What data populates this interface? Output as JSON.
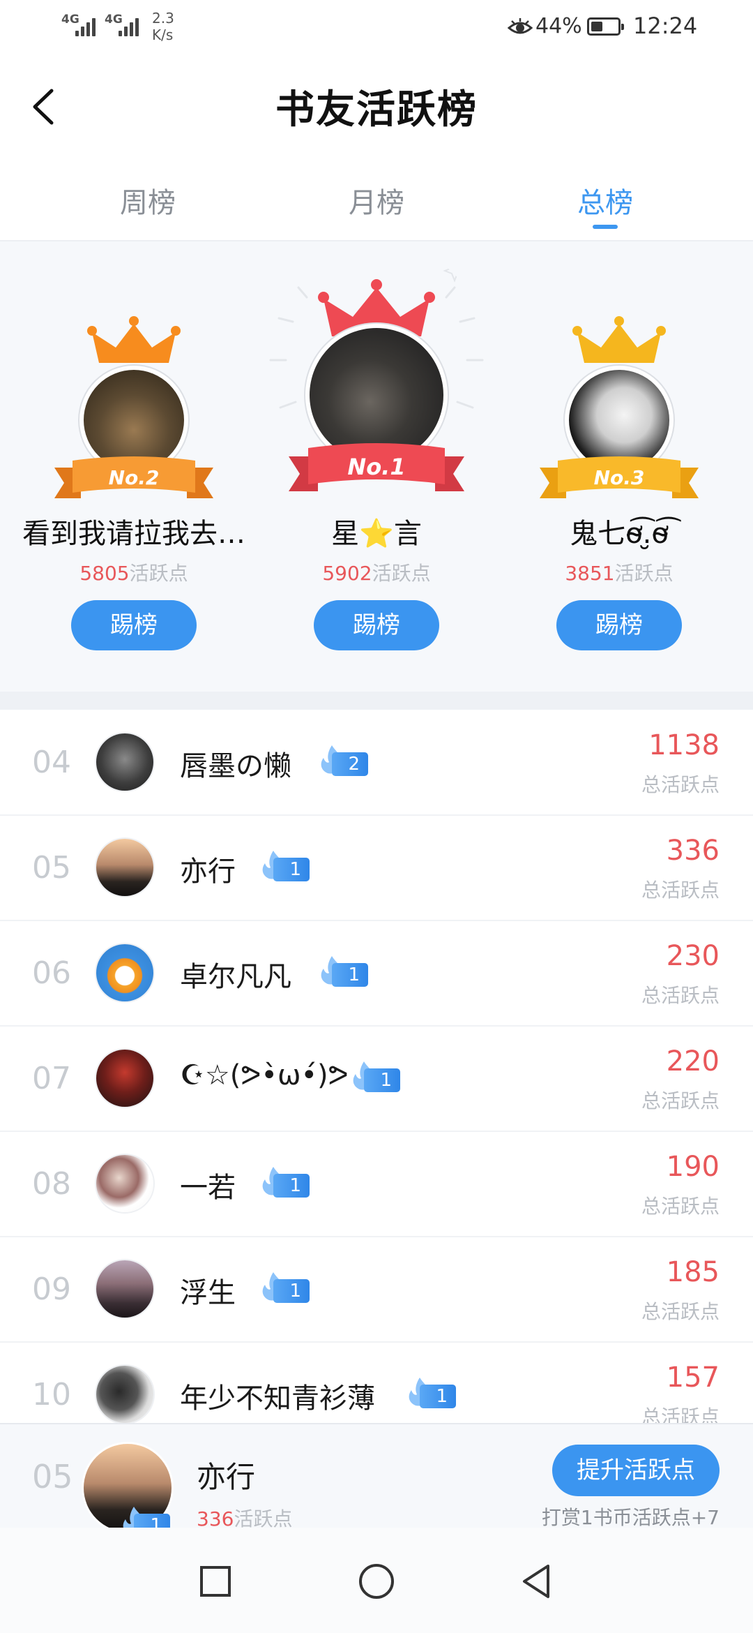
{
  "status_bar": {
    "net1": "4G",
    "net2": "4G",
    "speed_value": "2.3",
    "speed_unit": "K/s",
    "battery": "44%",
    "battery_level": 0.44,
    "time": "12:24",
    "icons": [
      "signal-icon",
      "eye-icon",
      "battery-icon"
    ]
  },
  "header": {
    "title": "书友活跃榜",
    "back_icon": "chevron-left-icon"
  },
  "tabs": [
    {
      "label": "周榜",
      "active": false
    },
    {
      "label": "月榜",
      "active": false
    },
    {
      "label": "总榜",
      "active": true
    }
  ],
  "podium": {
    "unit": "活跃点",
    "kick_label": "踢榜",
    "first": {
      "badge": "No.1",
      "name": "星⭐言",
      "points": "5902"
    },
    "second": {
      "badge": "No.2",
      "name": "看到我请拉我去…",
      "points": "5805"
    },
    "third": {
      "badge": "No.3",
      "name": "鬼七ơ̴̴̴̴̴̴͡.̮ơ̴̴͡",
      "points": "3851"
    }
  },
  "list": {
    "sub_label": "总活跃点",
    "rows": [
      {
        "rank": "04",
        "name": "唇墨の懒",
        "level": "2",
        "points": "1138"
      },
      {
        "rank": "05",
        "name": "亦行",
        "level": "1",
        "points": "336"
      },
      {
        "rank": "06",
        "name": "卓尔凡凡",
        "level": "1",
        "points": "230"
      },
      {
        "rank": "07",
        "name": "☪☆(ᕗ•̀ω•́)ᕗ",
        "level": "1",
        "points": "220"
      },
      {
        "rank": "08",
        "name": "一若",
        "level": "1",
        "points": "190"
      },
      {
        "rank": "09",
        "name": "浮生",
        "level": "1",
        "points": "185"
      },
      {
        "rank": "10",
        "name": "年少不知青衫薄",
        "level": "1",
        "points": "157"
      }
    ]
  },
  "my_rank": {
    "rank": "05",
    "name": "亦行",
    "level": "1",
    "points": "336",
    "unit": "活跃点",
    "boost_label": "提升活跃点",
    "hint": "打赏1书币活跃点+7"
  },
  "colors": {
    "accent": "#3b95f0",
    "points_red": "#e8575a",
    "gold": "#f5a623",
    "orange": "#f78c1e",
    "crimson": "#ee4a53"
  }
}
